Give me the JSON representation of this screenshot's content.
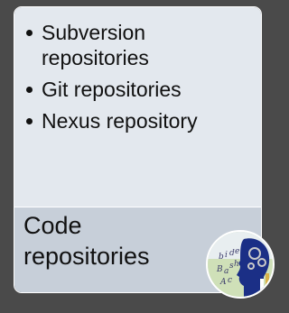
{
  "card": {
    "bullets": [
      "Subversion repositories",
      "Git repositories",
      "Nexus repository"
    ],
    "title_lines": [
      "Code",
      "repositories"
    ]
  },
  "logo": {
    "icon": "coder-head-icon",
    "letters": [
      "b",
      "i",
      "d",
      "e",
      "B",
      "a",
      "s",
      "h",
      "A",
      "c"
    ]
  },
  "colors": {
    "background": "#4a4a4a",
    "card_top": "#e3e8ee",
    "card_bottom": "#c7cfd9",
    "head_blue": "#1b2f86"
  }
}
